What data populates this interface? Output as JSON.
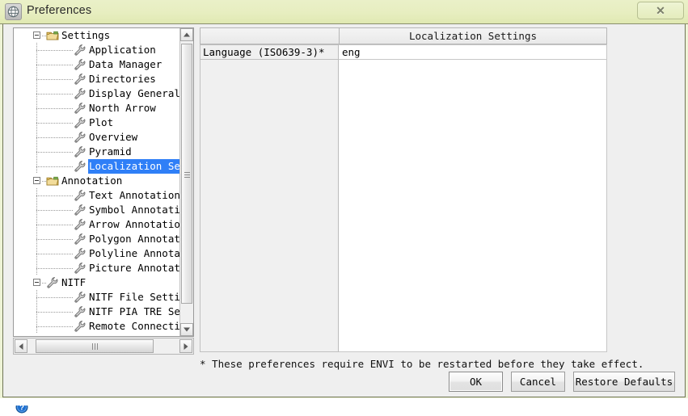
{
  "window": {
    "title": "Preferences",
    "app_icon": "globe-icon",
    "close_label": "✕",
    "titlebar_color": "#e7eec0",
    "frame_color": "#6f7456"
  },
  "tree": {
    "selection_color": "#2f7ff7",
    "selected_item": "Localization Settings",
    "items": [
      {
        "label": "Settings",
        "depth": 0,
        "icon": "folder-icon",
        "expandable": true,
        "expanded": true,
        "selected": false
      },
      {
        "label": "Application",
        "depth": 1,
        "icon": "wrench-icon",
        "expandable": false,
        "expanded": false,
        "selected": false
      },
      {
        "label": "Data Manager",
        "depth": 1,
        "icon": "wrench-icon",
        "expandable": false,
        "expanded": false,
        "selected": false
      },
      {
        "label": "Directories",
        "depth": 1,
        "icon": "wrench-icon",
        "expandable": false,
        "expanded": false,
        "selected": false
      },
      {
        "label": "Display General",
        "depth": 1,
        "icon": "wrench-icon",
        "expandable": false,
        "expanded": false,
        "selected": false
      },
      {
        "label": "North Arrow",
        "depth": 1,
        "icon": "wrench-icon",
        "expandable": false,
        "expanded": false,
        "selected": false
      },
      {
        "label": "Plot",
        "depth": 1,
        "icon": "wrench-icon",
        "expandable": false,
        "expanded": false,
        "selected": false
      },
      {
        "label": "Overview",
        "depth": 1,
        "icon": "wrench-icon",
        "expandable": false,
        "expanded": false,
        "selected": false
      },
      {
        "label": "Pyramid",
        "depth": 1,
        "icon": "wrench-icon",
        "expandable": false,
        "expanded": false,
        "selected": false
      },
      {
        "label": "Localization Settings",
        "depth": 1,
        "icon": "wrench-icon",
        "expandable": false,
        "expanded": false,
        "selected": true
      },
      {
        "label": "Annotation",
        "depth": 0,
        "icon": "folder-icon",
        "expandable": true,
        "expanded": true,
        "selected": false
      },
      {
        "label": "Text Annotation",
        "depth": 1,
        "icon": "wrench-icon",
        "expandable": false,
        "expanded": false,
        "selected": false
      },
      {
        "label": "Symbol Annotation",
        "depth": 1,
        "icon": "wrench-icon",
        "expandable": false,
        "expanded": false,
        "selected": false
      },
      {
        "label": "Arrow Annotation",
        "depth": 1,
        "icon": "wrench-icon",
        "expandable": false,
        "expanded": false,
        "selected": false
      },
      {
        "label": "Polygon Annotation",
        "depth": 1,
        "icon": "wrench-icon",
        "expandable": false,
        "expanded": false,
        "selected": false
      },
      {
        "label": "Polyline Annotation",
        "depth": 1,
        "icon": "wrench-icon",
        "expandable": false,
        "expanded": false,
        "selected": false
      },
      {
        "label": "Picture Annotation",
        "depth": 1,
        "icon": "wrench-icon",
        "expandable": false,
        "expanded": false,
        "selected": false
      },
      {
        "label": "NITF",
        "depth": 0,
        "icon": "wrench-icon",
        "expandable": true,
        "expanded": true,
        "selected": false
      },
      {
        "label": "NITF File Settings",
        "depth": 1,
        "icon": "wrench-icon",
        "expandable": false,
        "expanded": false,
        "selected": false
      },
      {
        "label": "NITF PIA TRE Settings",
        "depth": 1,
        "icon": "wrench-icon",
        "expandable": false,
        "expanded": false,
        "selected": false
      },
      {
        "label": "Remote Connectivity",
        "depth": 1,
        "icon": "wrench-icon",
        "expandable": false,
        "expanded": false,
        "selected": false
      }
    ],
    "vscrollbar": {
      "up_arrow": "scroll-up-arrow",
      "down_arrow": "scroll-down-arrow"
    },
    "hscrollbar": {
      "left_arrow": "scroll-left-arrow",
      "right_arrow": "scroll-right-arrow"
    }
  },
  "settings": {
    "panel_title": "Localization Settings",
    "rows": [
      {
        "label": "Language (ISO639-3)*",
        "value": "eng"
      }
    ]
  },
  "footnote": "* These preferences require ENVI to be restarted before they take effect.",
  "buttons": {
    "ok": "OK",
    "cancel": "Cancel",
    "restore": "Restore Defaults"
  },
  "help": {
    "icon": "help-question-icon"
  }
}
